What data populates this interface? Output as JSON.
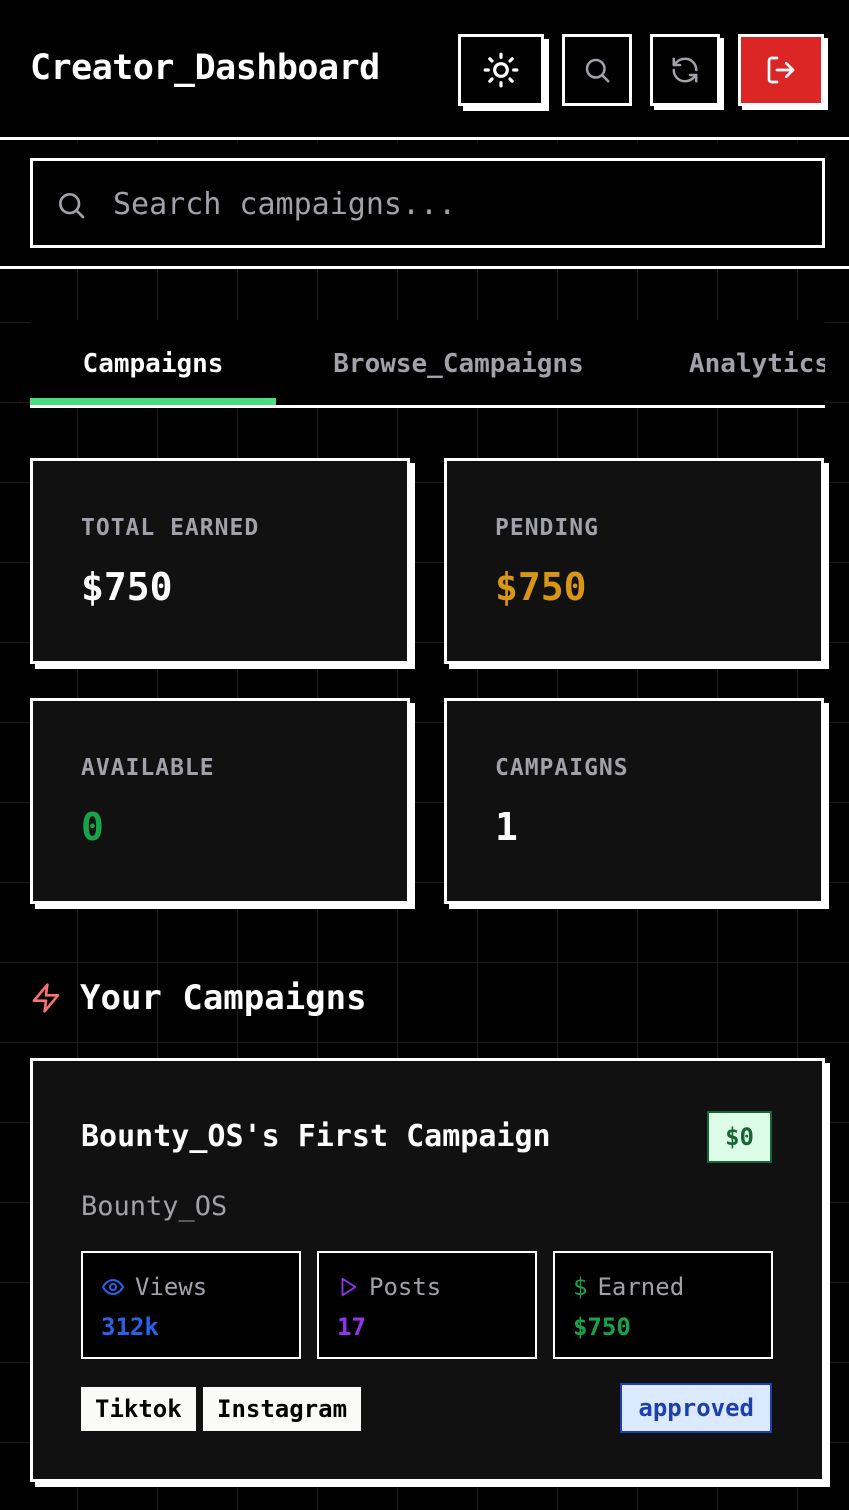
{
  "header": {
    "title": "Creator_Dashboard",
    "buttons": {
      "theme": "sun-icon",
      "search": "search-icon",
      "refresh": "refresh-icon",
      "logout": "logout-icon"
    }
  },
  "search": {
    "placeholder": "Search campaigns...",
    "value": ""
  },
  "tabs": [
    {
      "label": "Campaigns",
      "active": true
    },
    {
      "label": "Browse_Campaigns",
      "active": false
    },
    {
      "label": "Analytics",
      "active": false
    }
  ],
  "stats": [
    {
      "label": "TOTAL EARNED",
      "value": "$750",
      "color": "#ffffff"
    },
    {
      "label": "PENDING",
      "value": "$750",
      "color": "#d89614"
    },
    {
      "label": "AVAILABLE",
      "value": "0",
      "color": "#16a34a"
    },
    {
      "label": "CAMPAIGNS",
      "value": "1",
      "color": "#ffffff"
    }
  ],
  "section": {
    "title": "Your Campaigns",
    "icon": "zap-icon"
  },
  "campaign": {
    "title": "Bounty_OS's First Campaign",
    "amount": "$0",
    "brand": "Bounty_OS",
    "metrics": [
      {
        "label": "Views",
        "value": "312k",
        "icon": "eye-icon",
        "color": "#2563eb"
      },
      {
        "label": "Posts",
        "value": "17",
        "icon": "play-icon",
        "color": "#9333ea"
      },
      {
        "label": "Earned",
        "value": "$750",
        "icon": "dollar-icon",
        "color": "#16a34a"
      }
    ],
    "platforms": [
      "Tiktok",
      "Instagram"
    ],
    "status": "approved"
  },
  "colors": {
    "accent": "#4ade80",
    "logout": "#dc2626",
    "background": "#000000",
    "card": "#111111"
  }
}
